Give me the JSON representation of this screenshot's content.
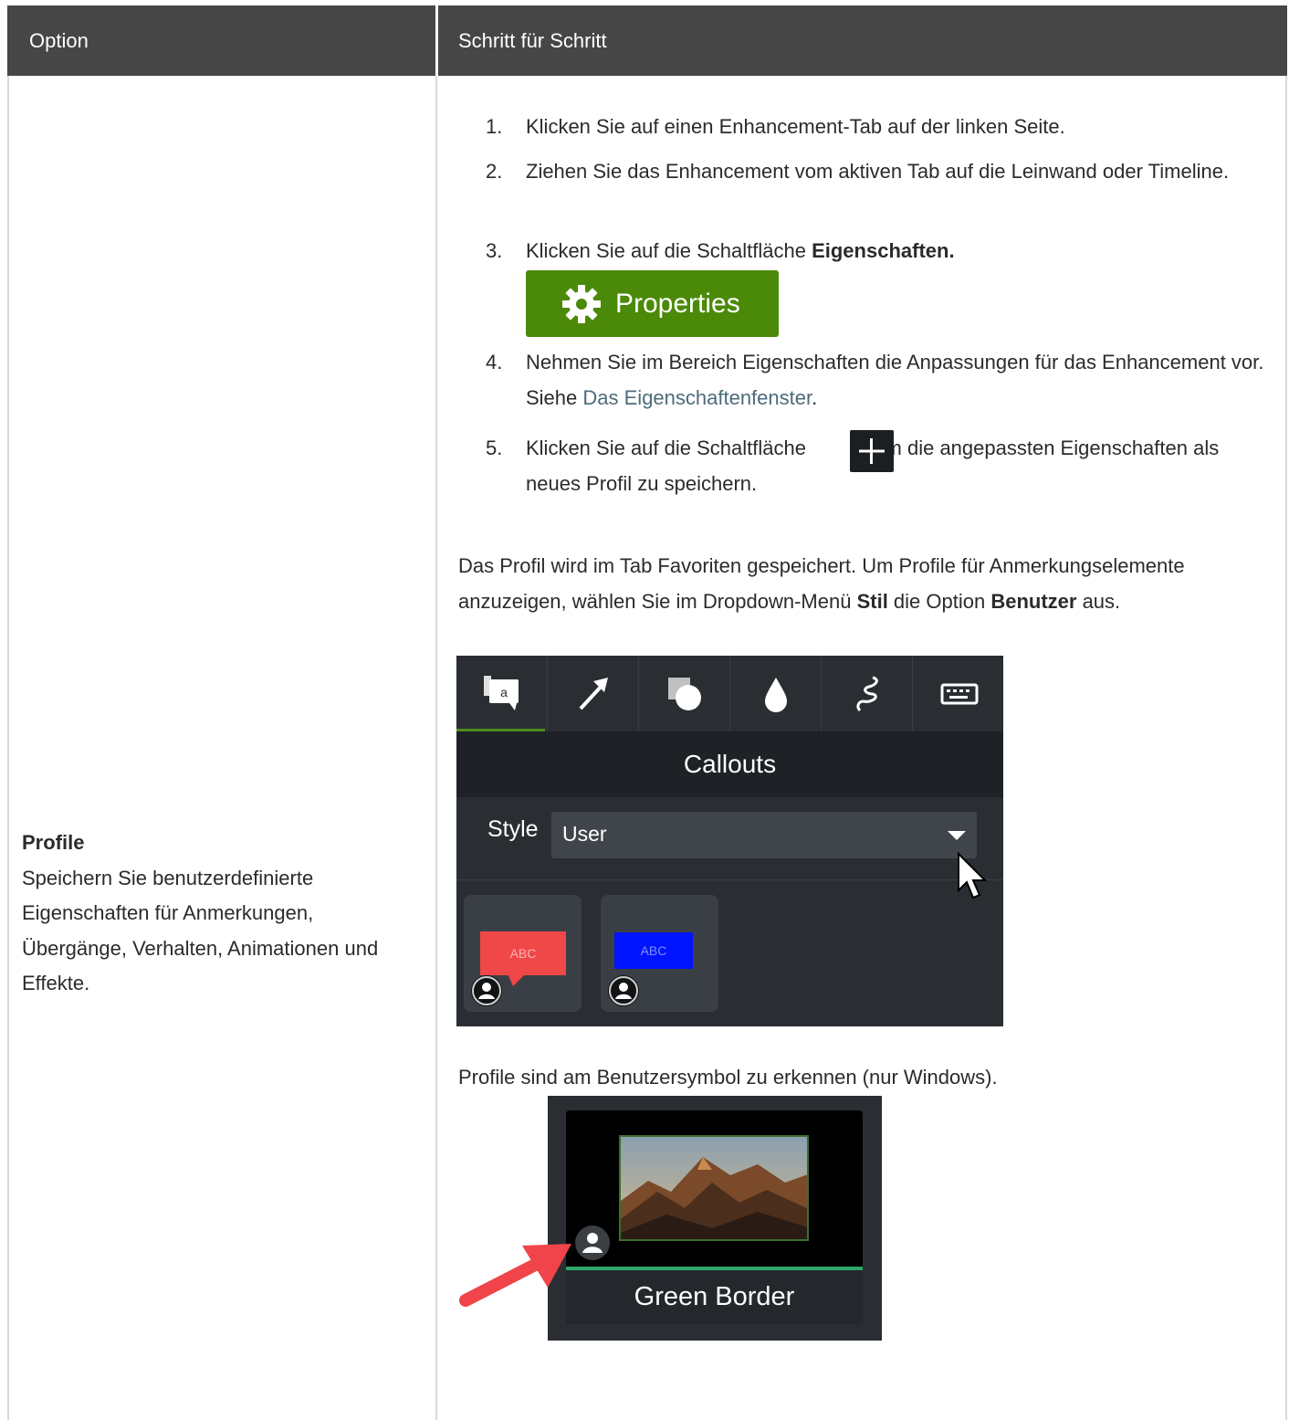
{
  "table": {
    "header_option": "Option",
    "header_steps": "Schritt für Schritt"
  },
  "left": {
    "title": "Profile",
    "description": "Speichern Sie benutzerdefinierte Eigenschaften für Anmerkungen, Übergänge, Verhalten, Animationen und Effekte."
  },
  "steps": [
    {
      "num": "1.",
      "text": "Klicken Sie auf einen Enhancement-Tab auf der linken Seite."
    },
    {
      "num": "2.",
      "text": "Ziehen Sie das Enhancement vom aktiven Tab auf die Leinwand oder Timeline."
    },
    {
      "num": "3.",
      "pre": "Klicken Sie auf die Schaltfläche ",
      "bold": "Eigenschaften."
    },
    {
      "num": "4.",
      "pre": "Nehmen Sie im Bereich Eigenschaften die Anpassungen für das Enhancement vor. Siehe ",
      "link": "Das Eigenschaftenfenster",
      "post": "."
    },
    {
      "num": "5.",
      "pre": "Klicken Sie auf die Schaltfläche ",
      "post": ", um die angepassten Eigenschaften als neues Profil zu speichern."
    }
  ],
  "properties_button": {
    "label": "Properties",
    "color": "#4b8a08"
  },
  "paragraph1": {
    "a": "Das Profil wird im Tab Favoriten gespeichert. Um Profile für Anmerkungselemente anzuzeigen, wählen Sie im Dropdown-Menü ",
    "b1": "Stil",
    "c": " die Option ",
    "b2": "Benutzer",
    "d": " aus."
  },
  "callouts_panel": {
    "tabs": [
      "callouts-icon",
      "arrow-icon",
      "shapes-icon",
      "blur-icon",
      "sketch-motion-icon",
      "keyboard-icon"
    ],
    "title": "Callouts",
    "style_label": "Style",
    "style_value": "User",
    "thumb1_text": "ABC",
    "thumb2_text": "ABC"
  },
  "paragraph2": "Profile sind am Benutzersymbol zu erkennen (nur Windows).",
  "green_border": {
    "label": "Green Border"
  }
}
